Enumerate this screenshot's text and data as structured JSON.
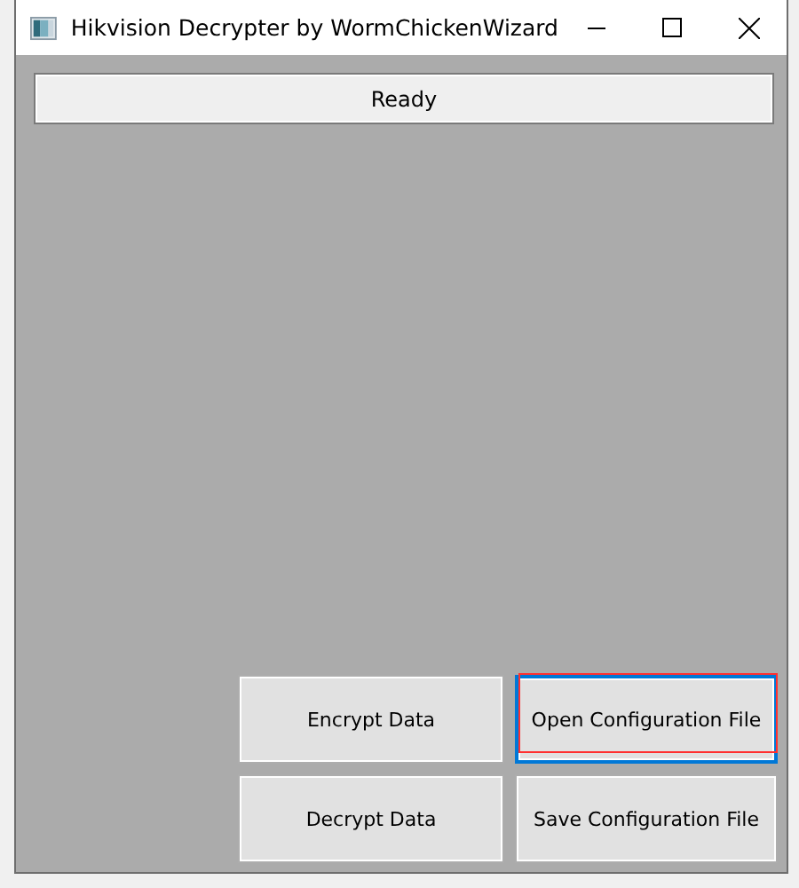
{
  "window": {
    "title": "Hikvision Decrypter by WormChickenWizard"
  },
  "status": "Ready",
  "buttons": [
    {
      "label": "Encrypt Data",
      "focused": false,
      "highlighted": false
    },
    {
      "label": "Open Configuration File",
      "focused": true,
      "highlighted": true
    },
    {
      "label": "Decrypt Data",
      "focused": false,
      "highlighted": false
    },
    {
      "label": "Save Configuration File",
      "focused": false,
      "highlighted": false
    }
  ]
}
